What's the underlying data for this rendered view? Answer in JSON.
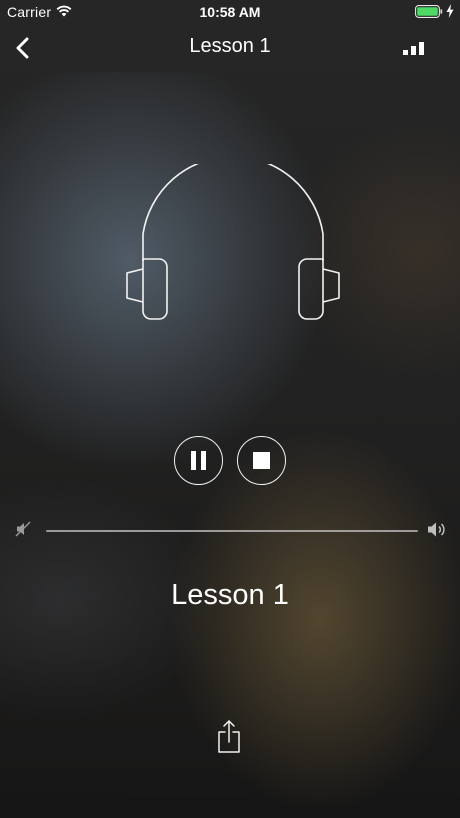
{
  "status_bar": {
    "carrier": "Carrier",
    "time": "10:58 AM",
    "wifi_icon": "wifi-icon",
    "battery_icon": "battery-charging-icon",
    "battery_color": "#4cd964"
  },
  "nav": {
    "back_icon": "chevron-left-icon",
    "title": "Lesson 1",
    "levels_icon": "signal-bars-icon"
  },
  "player": {
    "artwork_icon": "headphones-icon",
    "pause_icon": "pause-icon",
    "stop_icon": "stop-icon",
    "volume_min_icon": "speaker-muted-icon",
    "volume_max_icon": "speaker-loud-icon",
    "track_title": "Lesson 1",
    "share_icon": "share-icon"
  },
  "colors": {
    "bar_background": "#262626",
    "foreground": "#ffffff",
    "slider_track": "#b9b9b9"
  }
}
